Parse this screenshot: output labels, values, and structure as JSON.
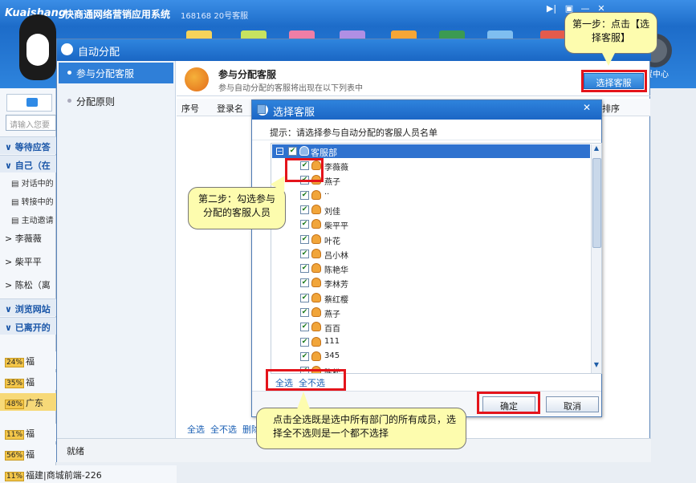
{
  "app": {
    "brand": "Kuaishang",
    "title": "快商通网络营销应用系统",
    "user_id": "168168",
    "user_label": "20号客服",
    "settings_label": "置中心"
  },
  "left_panel": {
    "search_placeholder": "请输入您要",
    "rows": [
      {
        "label": "等待应答",
        "type": "group"
      },
      {
        "label": "自己（在",
        "type": "group"
      },
      {
        "label": "对话中的",
        "type": "sub"
      },
      {
        "label": "转接中的",
        "type": "sub"
      },
      {
        "label": "主动邀请",
        "type": "sub"
      },
      {
        "label": "李薇薇",
        "type": "plain"
      },
      {
        "label": "柴平平",
        "type": "plain"
      },
      {
        "label": "陈松（离",
        "type": "plain"
      },
      {
        "label": "浏览网站",
        "type": "group"
      },
      {
        "label": "已离开的",
        "type": "group"
      }
    ],
    "visitors": [
      {
        "pct": "24%",
        "text": "福"
      },
      {
        "pct": "35%",
        "text": "福"
      },
      {
        "pct": "48%",
        "text": "广东"
      },
      {
        "pct": "11%",
        "text": "福"
      },
      {
        "pct": "56%",
        "text": "福"
      },
      {
        "pct": "11%",
        "text": "福建|商城前端-226"
      }
    ]
  },
  "auto_assign": {
    "title": "自动分配",
    "nav": [
      "参与分配客服",
      "分配原则"
    ],
    "header_title": "参与分配客服",
    "header_subtitle": "参与自动分配的客服将出现在以下列表中",
    "choose_button": "选择客服",
    "columns": [
      "序号",
      "登录名",
      "排序"
    ],
    "footer_links": [
      "全选",
      "全不选",
      "删除"
    ],
    "status": "就绪"
  },
  "choose_agent": {
    "title": "选择客服",
    "close": "✕",
    "tip": "提示：请选择参与自动分配的客服人员名单",
    "department": "客服部",
    "agents": [
      "李薇薇",
      "燕子",
      "··",
      "刘佳",
      "柴平平",
      "叶花",
      "吕小林",
      "陈艳华",
      "李林芳",
      "蔡红樱",
      "燕子",
      "百百",
      "111",
      "345",
      "陈松"
    ],
    "select_all": "全选",
    "select_none": "全不选",
    "ok": "确定",
    "cancel": "取消"
  },
  "callouts": {
    "step1": "第一步：点击【选择客服】",
    "step2": "第二步：勾选参与分配的客服人员",
    "step3": "点击全选既是选中所有部门的所有成员，选择全不选则是一个都不选择"
  },
  "colors": {
    "titlebar": "#1c66c5",
    "highlight": "#e4141b",
    "callout": "#fdfcae",
    "selected_row": "#2f72cf"
  }
}
